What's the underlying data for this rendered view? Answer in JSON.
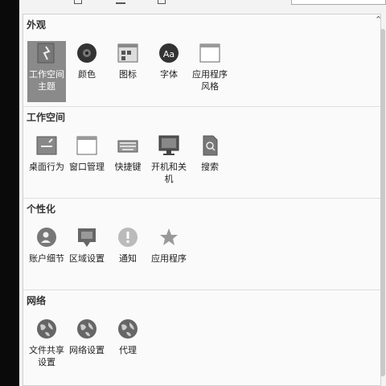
{
  "sections": [
    {
      "title": "外观",
      "items": [
        "工作空间\n主题",
        "颜色",
        "图标",
        "字体",
        "应用程序\n风格"
      ]
    },
    {
      "title": "工作空间",
      "items": [
        "桌面行为",
        "窗口管理",
        "快捷键",
        "开机和关\n机",
        "搜索"
      ]
    },
    {
      "title": "个性化",
      "items": [
        "账户细节",
        "区域设置",
        "通知",
        "应用程序"
      ]
    },
    {
      "title": "网络",
      "items": [
        "文件共享\n设置",
        "网络设置",
        "代理"
      ]
    }
  ],
  "icons": {
    "appearance": [
      "workspace-theme-icon",
      "color-icon",
      "icons-icon",
      "font-icon",
      "app-style-icon"
    ],
    "workspace": [
      "desktop-behavior-icon",
      "window-management-icon",
      "shortcuts-icon",
      "startup-shutdown-icon",
      "search-icon"
    ],
    "personalization": [
      "account-details-icon",
      "region-settings-icon",
      "notifications-icon",
      "applications-icon"
    ],
    "network": [
      "file-sharing-icon",
      "network-settings-icon",
      "proxy-icon"
    ]
  },
  "font_icon_text": "Aa"
}
